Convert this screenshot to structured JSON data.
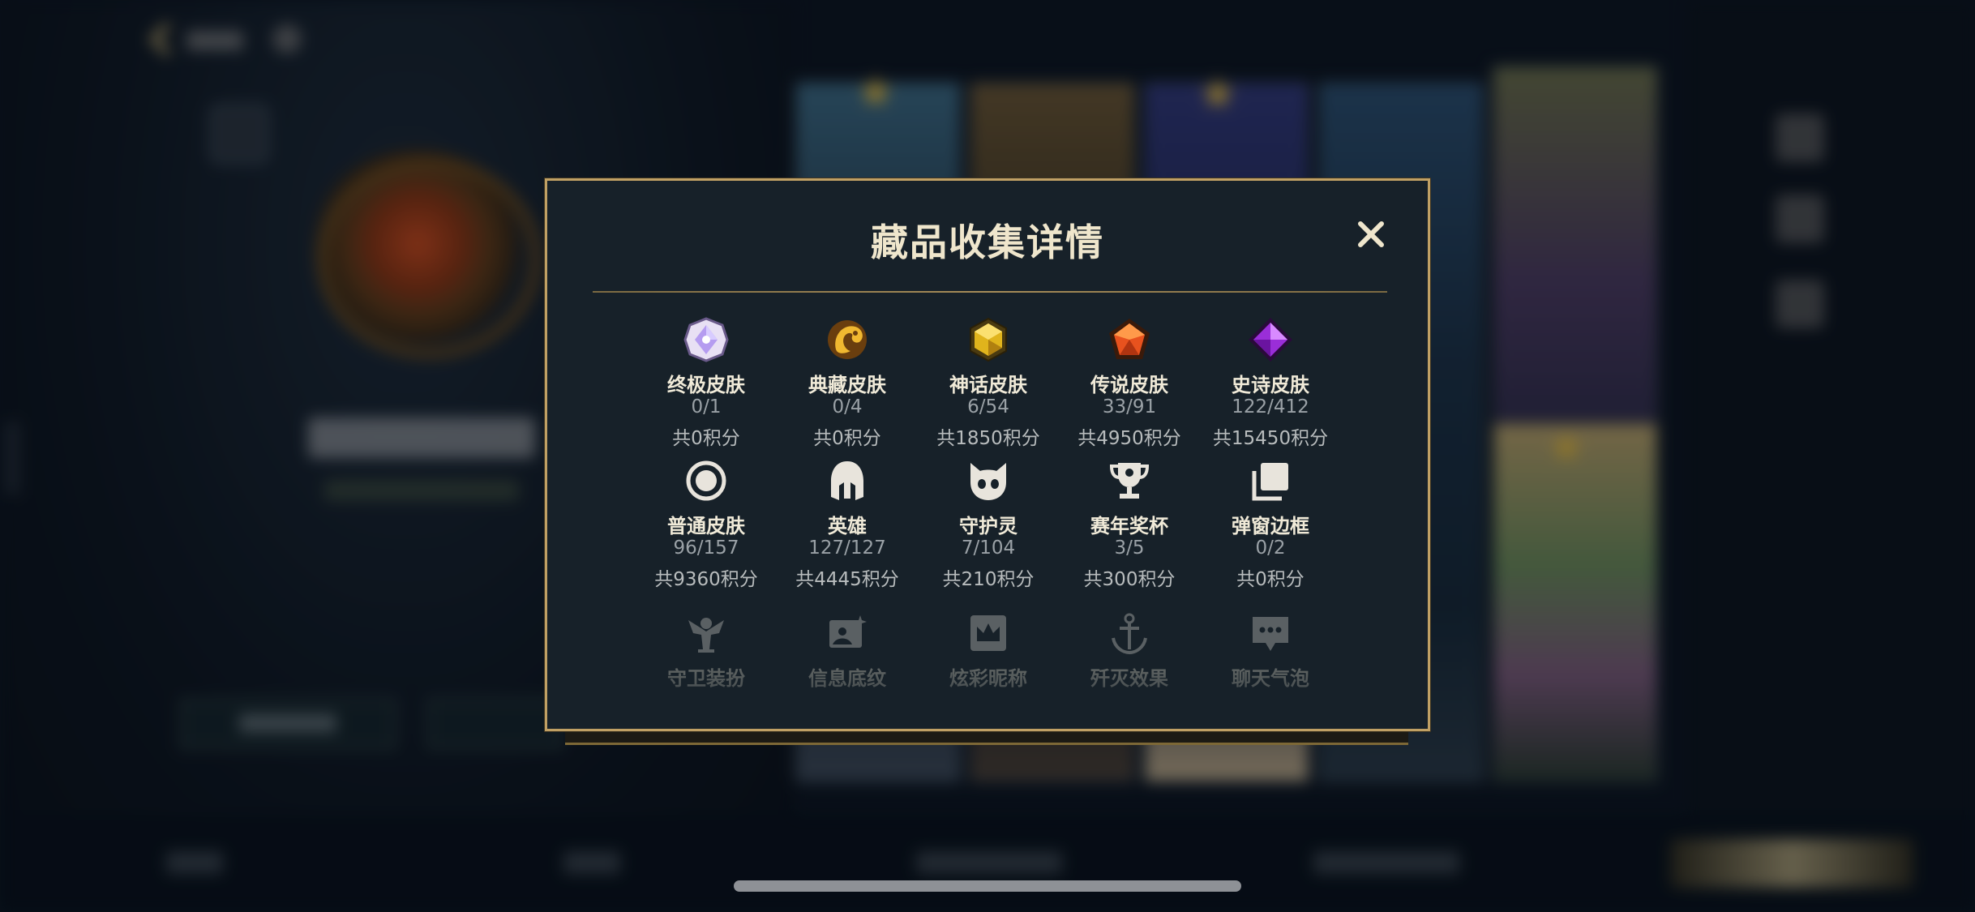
{
  "modal": {
    "title": "藏品收集详情",
    "close_label": "✕",
    "items": [
      {
        "name": "终极皮肤",
        "count": "0/1",
        "points": "共0积分",
        "icon": "ultimate-gem-icon"
      },
      {
        "name": "典藏皮肤",
        "count": "0/4",
        "points": "共0积分",
        "icon": "prestige-dragon-icon"
      },
      {
        "name": "神话皮肤",
        "count": "6/54",
        "points": "共1850积分",
        "icon": "mythic-gem-icon"
      },
      {
        "name": "传说皮肤",
        "count": "33/91",
        "points": "共4950积分",
        "icon": "legendary-gem-icon"
      },
      {
        "name": "史诗皮肤",
        "count": "122/412",
        "points": "共15450积分",
        "icon": "epic-gem-icon"
      },
      {
        "name": "普通皮肤",
        "count": "96/157",
        "points": "共9360积分",
        "icon": "standard-circle-icon"
      },
      {
        "name": "英雄",
        "count": "127/127",
        "points": "共4445积分",
        "icon": "champion-helmet-icon"
      },
      {
        "name": "守护灵",
        "count": "7/104",
        "points": "共210积分",
        "icon": "little-legend-icon"
      },
      {
        "name": "赛年奖杯",
        "count": "3/5",
        "points": "共300积分",
        "icon": "trophy-icon"
      },
      {
        "name": "弹窗边框",
        "count": "0/2",
        "points": "共0积分",
        "icon": "frame-icon"
      },
      {
        "name": "守卫装扮",
        "icon": "ward-skin-icon"
      },
      {
        "name": "信息底纹",
        "icon": "banner-icon"
      },
      {
        "name": "炫彩昵称",
        "icon": "crown-name-icon"
      },
      {
        "name": "歼灭效果",
        "icon": "ace-effect-icon"
      },
      {
        "name": "聊天气泡",
        "icon": "chat-bubble-icon"
      }
    ]
  },
  "colors": {
    "modal_border": "#c0a064",
    "modal_bg": "#172129",
    "title_text": "#efe6cc",
    "count_text": "#9aa1a6"
  }
}
